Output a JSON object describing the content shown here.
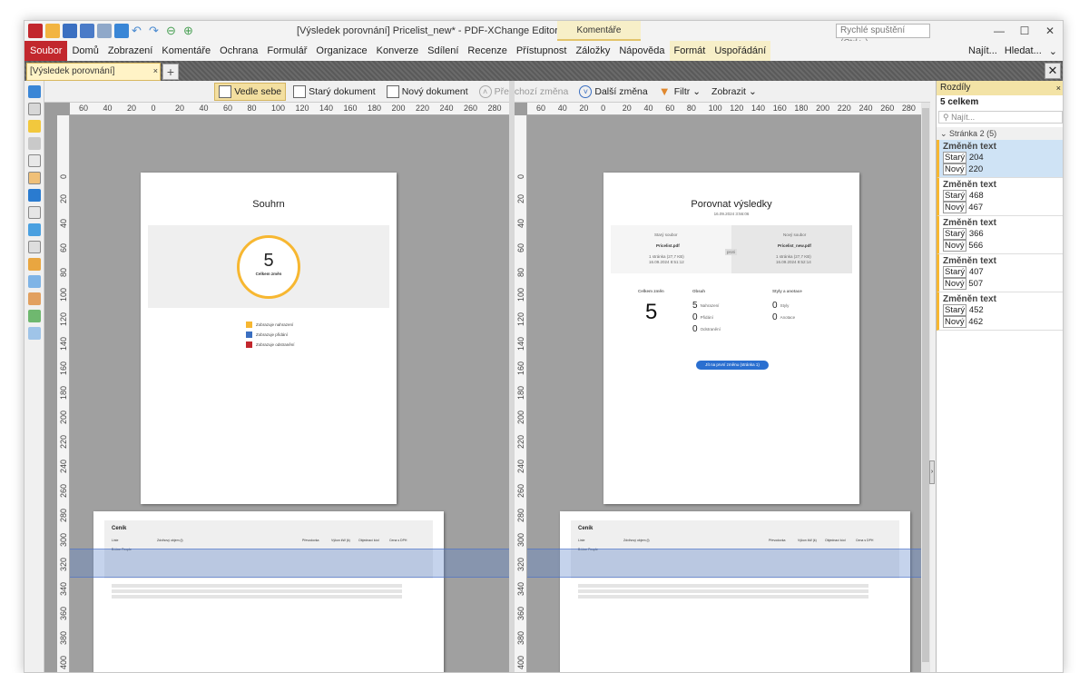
{
  "app": {
    "title": "[Výsledek porovnání] Pricelist_new* - PDF-XChange Editor",
    "context_tab_group": "Komentáře",
    "quick_launch_placeholder": "Rychlé spuštění (Ctrl+.)",
    "window_controls": [
      "—",
      "☐",
      "✕"
    ]
  },
  "menu": {
    "file": "Soubor",
    "items": [
      "Domů",
      "Zobrazení",
      "Komentáře",
      "Ochrana",
      "Formulář",
      "Organizace",
      "Konverze",
      "Sdílení",
      "Recenze",
      "Přístupnost",
      "Záložky",
      "Nápověda"
    ],
    "context_items": [
      "Formát",
      "Uspořádání"
    ],
    "right": [
      "Najít...",
      "Hledat..."
    ]
  },
  "doc_tab": {
    "label": "[Výsledek porovnání] Pricelist_new *",
    "close": "×",
    "new_tab": "+",
    "close_all": "✕"
  },
  "compare_toolbar": {
    "side_by_side": "Vedle sebe",
    "old_doc": "Starý dokument",
    "new_doc": "Nový dokument",
    "prev_change": "Předchozí změna",
    "next_change": "Další změna",
    "filter": "Filtr",
    "show": "Zobrazit"
  },
  "ruler": {
    "h_labels": [
      "60",
      "40",
      "20",
      "0",
      "20",
      "40",
      "60",
      "80",
      "100",
      "120",
      "140",
      "160",
      "180",
      "200",
      "220",
      "240",
      "260",
      "280"
    ],
    "v_labels": [
      "0",
      "20",
      "40",
      "60",
      "80",
      "100",
      "120",
      "140",
      "160",
      "180",
      "200",
      "220",
      "240",
      "260",
      "280",
      "300",
      "320",
      "340",
      "360",
      "380",
      "400"
    ]
  },
  "left_page": {
    "title": "Souhrn",
    "total_number": "5",
    "total_label": "Celkem změn",
    "legend": [
      "Zobrazuje nahrazení",
      "Zobrazuje přidání",
      "Zobrazuje odstranění"
    ]
  },
  "right_page": {
    "title": "Porovnat výsledky",
    "date": "16.09.2024 3:56:06",
    "old_label": "Starý soubor",
    "old_name": "Pricelist.pdf",
    "old_info": "1 stránka (27,7 KB)",
    "old_date": "16.09.2024 8:51:12",
    "versus": "proti",
    "new_label": "Nový soubor",
    "new_name": "Pricelist_new.pdf",
    "new_info": "1 stránka (27,7 KB)",
    "new_date": "16.09.2024 8:52:14",
    "total_label": "Celkem změn",
    "total_number": "5",
    "content_label": "Obsah",
    "styles_label": "Styly a anotace",
    "stats": [
      {
        "n": "5",
        "label": "Nahrazení"
      },
      {
        "n": "0",
        "label": "Přidání"
      },
      {
        "n": "0",
        "label": "Odstranění"
      }
    ],
    "style_stats": [
      {
        "n": "0",
        "label": "Styly"
      },
      {
        "n": "0",
        "label": "Anotace"
      }
    ],
    "go_button": "Jít na první změnu (stránka 1)"
  },
  "pricelist": {
    "title": "Ceník",
    "headers": [
      "Linie",
      "Zdvihový objem (l)",
      "Převodovka",
      "Výkon kW (k)",
      "Objednací kód",
      "Cena s DPH"
    ],
    "first_cell": "B-Line People"
  },
  "differences_panel": {
    "title": "Rozdíly",
    "total": "5 celkem",
    "search_placeholder": "Najít...",
    "group": "Stránka 2 (5)",
    "changes": [
      {
        "type": "Změněn text",
        "old_tag": "Starý",
        "old": "204",
        "new_tag": "Nový",
        "new": "220",
        "selected": true
      },
      {
        "type": "Změněn text",
        "old_tag": "Starý",
        "old": "468",
        "new_tag": "Nový",
        "new": "467",
        "selected": false
      },
      {
        "type": "Změněn text",
        "old_tag": "Starý",
        "old": "366",
        "new_tag": "Nový",
        "new": "566",
        "selected": false
      },
      {
        "type": "Změněn text",
        "old_tag": "Starý",
        "old": "407",
        "new_tag": "Nový",
        "new": "507",
        "selected": false
      },
      {
        "type": "Změněn text",
        "old_tag": "Starý",
        "old": "452",
        "new_tag": "Nový",
        "new": "462",
        "selected": false
      }
    ]
  },
  "colors": {
    "accent_red": "#c2272d",
    "ring": "#f7b731",
    "highlight": "#5a82c8",
    "selected_row": "#cfe3f5",
    "panel_header": "#f3e3a6"
  }
}
